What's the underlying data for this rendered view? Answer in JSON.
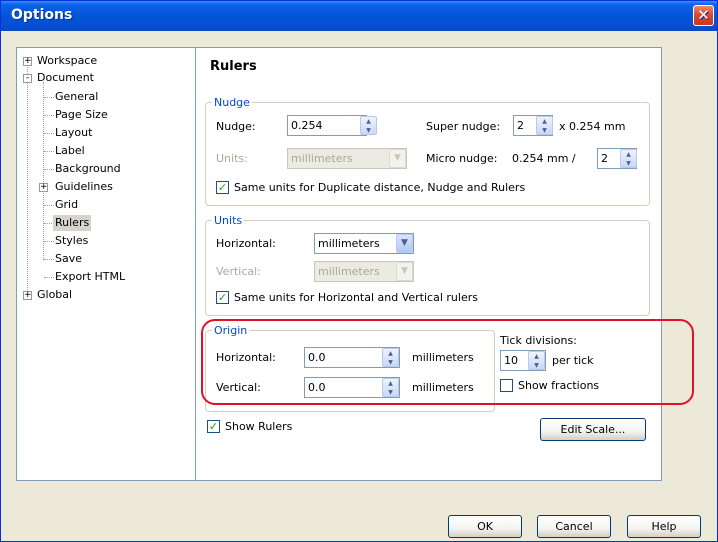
{
  "window": {
    "title": "Options"
  },
  "tree": {
    "items": [
      {
        "label": "Workspace",
        "expander": "+"
      },
      {
        "label": "Document",
        "expander": "-"
      },
      {
        "label": "General"
      },
      {
        "label": "Page Size"
      },
      {
        "label": "Layout"
      },
      {
        "label": "Label"
      },
      {
        "label": "Background"
      },
      {
        "label": "Guidelines",
        "expander": "+"
      },
      {
        "label": "Grid"
      },
      {
        "label": "Rulers",
        "selected": true
      },
      {
        "label": "Styles"
      },
      {
        "label": "Save"
      },
      {
        "label": "Export HTML"
      },
      {
        "label": "Global",
        "expander": "+"
      }
    ]
  },
  "panel": {
    "title": "Rulers",
    "nudge_group": {
      "label": "Nudge",
      "nudge_label": "Nudge:",
      "nudge_value": "0.254",
      "super_nudge_label": "Super nudge:",
      "super_nudge_value": "2",
      "super_nudge_suffix": "x 0.254 mm",
      "units_label": "Units:",
      "units_value": "millimeters",
      "micro_nudge_label": "Micro nudge:",
      "micro_nudge_prefix": "0.254 mm /",
      "micro_nudge_value": "2",
      "same_units_label": "Same units for Duplicate distance, Nudge and Rulers",
      "same_units_checked": true
    },
    "units_group": {
      "label": "Units",
      "horizontal_label": "Horizontal:",
      "horizontal_value": "millimeters",
      "vertical_label": "Vertical:",
      "vertical_value": "millimeters",
      "same_units_label": "Same units for Horizontal and Vertical rulers",
      "same_units_checked": true
    },
    "origin_group": {
      "label": "Origin",
      "horizontal_label": "Horizontal:",
      "horizontal_value": "0.0",
      "horizontal_unit": "millimeters",
      "vertical_label": "Vertical:",
      "vertical_value": "0.0",
      "vertical_unit": "millimeters"
    },
    "tick": {
      "label": "Tick divisions:",
      "value": "10",
      "suffix": "per tick",
      "show_fractions_label": "Show fractions",
      "show_fractions_checked": false
    },
    "show_rulers_label": "Show Rulers",
    "show_rulers_checked": true,
    "edit_scale_label": "Edit Scale..."
  },
  "footer": {
    "ok_label": "OK",
    "cancel_label": "Cancel",
    "help_label": "Help"
  },
  "colors": {
    "title_bar": "#0454d8",
    "group_label": "#0046d5",
    "highlight": "#e0122a",
    "checkmark": "#21a121"
  }
}
